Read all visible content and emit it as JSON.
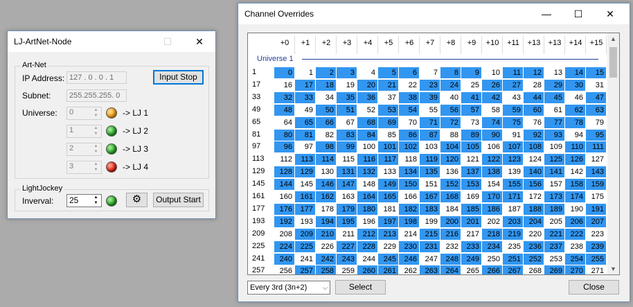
{
  "lj": {
    "title": "LJ-ArtNet-Node",
    "minimize": "—",
    "maximize": "☐",
    "close": "✕",
    "artnet_group": "Art-Net",
    "ip_label": "IP Address:",
    "ip_value": "127 . 0 . 0 . 1",
    "subnet_label": "Subnet:",
    "subnet_value": "255.255.255. 0",
    "universe_label": "Universe:",
    "universes": [
      {
        "value": "0",
        "led": "orange",
        "target": "-> LJ 1"
      },
      {
        "value": "1",
        "led": "green",
        "target": "-> LJ 2"
      },
      {
        "value": "2",
        "led": "green",
        "target": "-> LJ 3"
      },
      {
        "value": "3",
        "led": "red",
        "target": "-> LJ 4"
      }
    ],
    "input_stop": "Input Stop",
    "lightjockey_group": "LightJockey",
    "interval_label": "Inverval:",
    "interval_value": "25",
    "interval_led": "green",
    "output_start": "Output Start"
  },
  "co": {
    "title": "Channel Overrides",
    "minimize": "—",
    "maximize": "☐",
    "close": "✕",
    "headers": [
      "+0",
      "+1",
      "+2",
      "+3",
      "+4",
      "+5",
      "+6",
      "+7",
      "+8",
      "+9",
      "+10",
      "+11",
      "+13",
      "+13",
      "+14",
      "+15"
    ],
    "universe_label": "Universe 1",
    "row_labels": [
      "1",
      "17",
      "33",
      "49",
      "65",
      "81",
      "97",
      "113",
      "129",
      "145",
      "161",
      "177",
      "193",
      "209",
      "225",
      "241",
      "257"
    ],
    "selection_mode": "Every 3rd (3n+2)",
    "select_button": "Select",
    "close_button": "Close",
    "accent": "#3296f0"
  }
}
